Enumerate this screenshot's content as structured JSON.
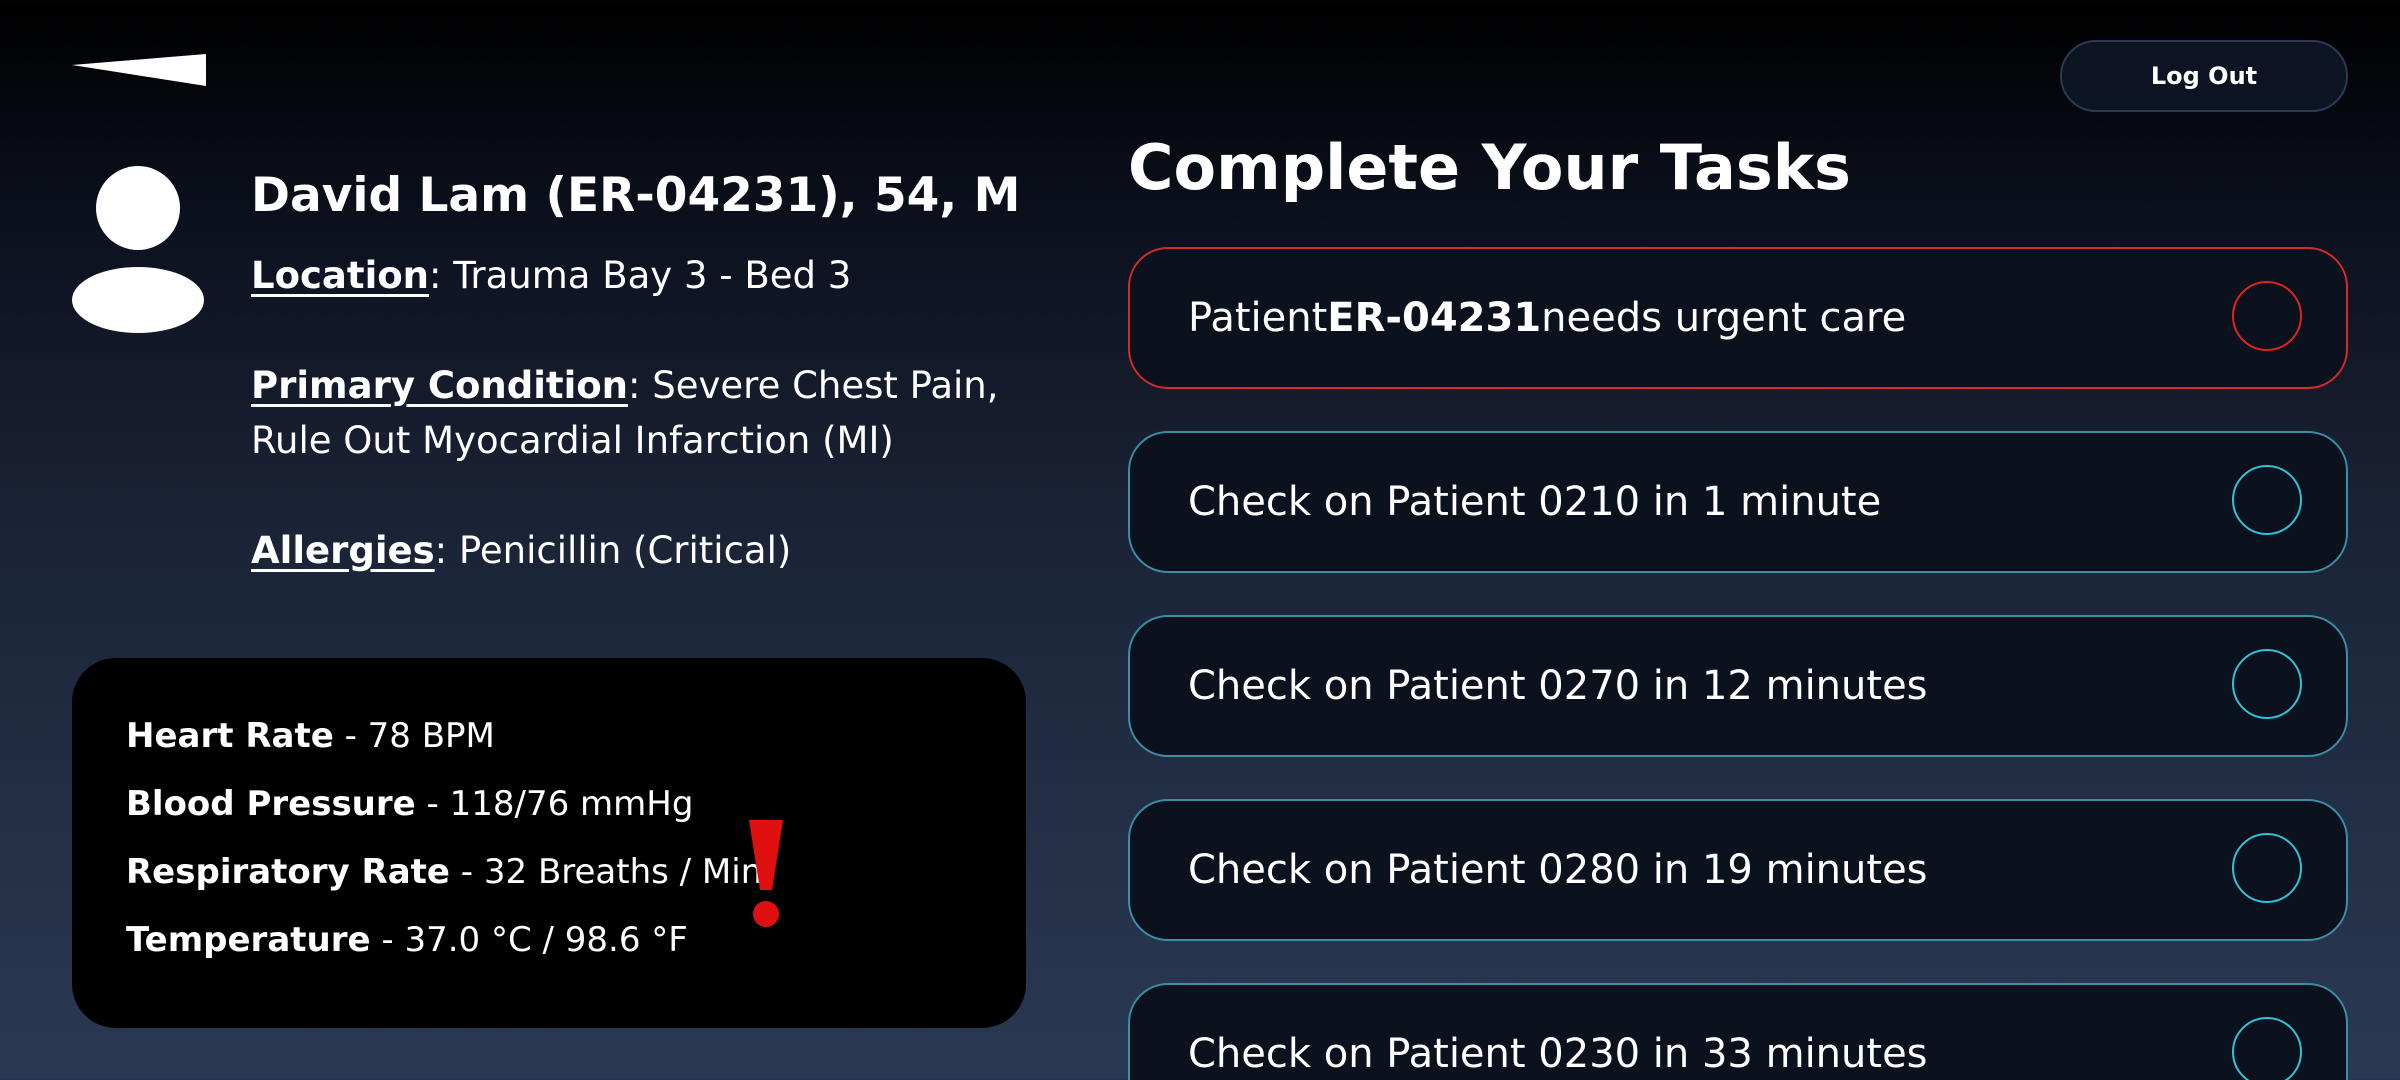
{
  "header": {
    "back_icon": "back-wedge-icon",
    "logout_label": "Log Out"
  },
  "patient": {
    "avatar_icon": "person-icon",
    "title": "David Lam (ER-04231), 54, M",
    "location_label": "Location",
    "location_value": ": Trauma Bay 3 - Bed 3",
    "condition_label": "Primary Condition",
    "condition_value_line1": ": Severe Chest Pain,",
    "condition_value_line2": "Rule Out Myocardial Infarction (MI)",
    "allergies_label": "Allergies",
    "allergies_value": ": Penicillin (Critical)"
  },
  "vitals": {
    "heart_rate_label": "Heart Rate",
    "heart_rate_value": " - 78 BPM",
    "blood_pressure_label": "Blood Pressure",
    "blood_pressure_value": " - 118/76 mmHg",
    "respiratory_rate_label": "Respiratory Rate",
    "respiratory_rate_value": " - 32 Breaths / Min",
    "temperature_label": "Temperature",
    "temperature_value": " - 37.0 °C / 98.6 °F",
    "alert_icon": "exclamation-icon",
    "alert_color": "#e01010"
  },
  "tasks": {
    "title": "Complete Your Tasks",
    "urgent_color": "#d42a2a",
    "normal_color": "#2ec3d6",
    "items": [
      {
        "prefix": "Patient ",
        "bold": "ER-04231",
        "suffix": " needs urgent care",
        "urgent": true
      },
      {
        "prefix": "Check on Patient 0210 in 1 minute",
        "bold": "",
        "suffix": "",
        "urgent": false
      },
      {
        "prefix": "Check on Patient 0270 in 12 minutes",
        "bold": "",
        "suffix": "",
        "urgent": false
      },
      {
        "prefix": "Check on Patient 0280 in 19 minutes",
        "bold": "",
        "suffix": "",
        "urgent": false
      },
      {
        "prefix": "Check on Patient 0230 in 33 minutes",
        "bold": "",
        "suffix": "",
        "urgent": false
      }
    ]
  }
}
